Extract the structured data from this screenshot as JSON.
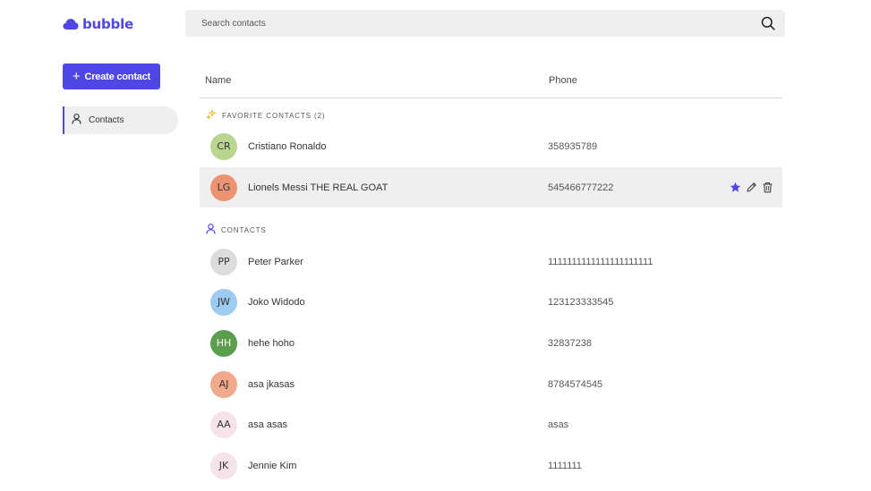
{
  "app": {
    "name": "bubble",
    "brand_color": "#4f46e5",
    "logo_icon": "cloud-icon"
  },
  "search": {
    "placeholder": "Search contacts",
    "icon": "search-icon"
  },
  "sidebar": {
    "create_label": "Create contact",
    "create_icon": "plus-icon",
    "items": [
      {
        "label": "Contacts",
        "icon": "person-icon",
        "active": true
      }
    ]
  },
  "table": {
    "columns": {
      "name": "Name",
      "phone": "Phone"
    }
  },
  "favorites": {
    "label": "FAVORITE CONTACTS (2)",
    "icon": "sparkles-icon",
    "rows": [
      {
        "initials": "CR",
        "name": "Cristiano Ronaldo",
        "phone": "358935789",
        "avatar_color": "#b9d58f"
      },
      {
        "initials": "LG",
        "name": "Lionels Messi THE REAL GOAT",
        "phone": "545466777222",
        "avatar_color": "#ec9372",
        "hovered": true
      }
    ]
  },
  "contacts": {
    "label": "CONTACTS",
    "icon": "person-icon",
    "rows": [
      {
        "initials": "PP",
        "name": "Peter Parker",
        "phone": "1111111111111111111111",
        "avatar_color": "#dcdcdc"
      },
      {
        "initials": "JW",
        "name": "Joko Widodo",
        "phone": "123123333545",
        "avatar_color": "#9ecbf2"
      },
      {
        "initials": "HH",
        "name": "hehe hoho",
        "phone": "32837238",
        "avatar_color": "#5b9e4e"
      },
      {
        "initials": "AJ",
        "name": "asa jkasas",
        "phone": "8784574545",
        "avatar_color": "#f0a98c"
      },
      {
        "initials": "AA",
        "name": "asa asas",
        "phone": "asas",
        "avatar_color": "#f6e3ea"
      },
      {
        "initials": "JK",
        "name": "Jennie Kim",
        "phone": "1111111",
        "avatar_color": "#f6e3ea"
      }
    ]
  },
  "row_actions": {
    "favorite_icon": "star-icon",
    "edit_icon": "pencil-icon",
    "delete_icon": "trash-icon"
  }
}
